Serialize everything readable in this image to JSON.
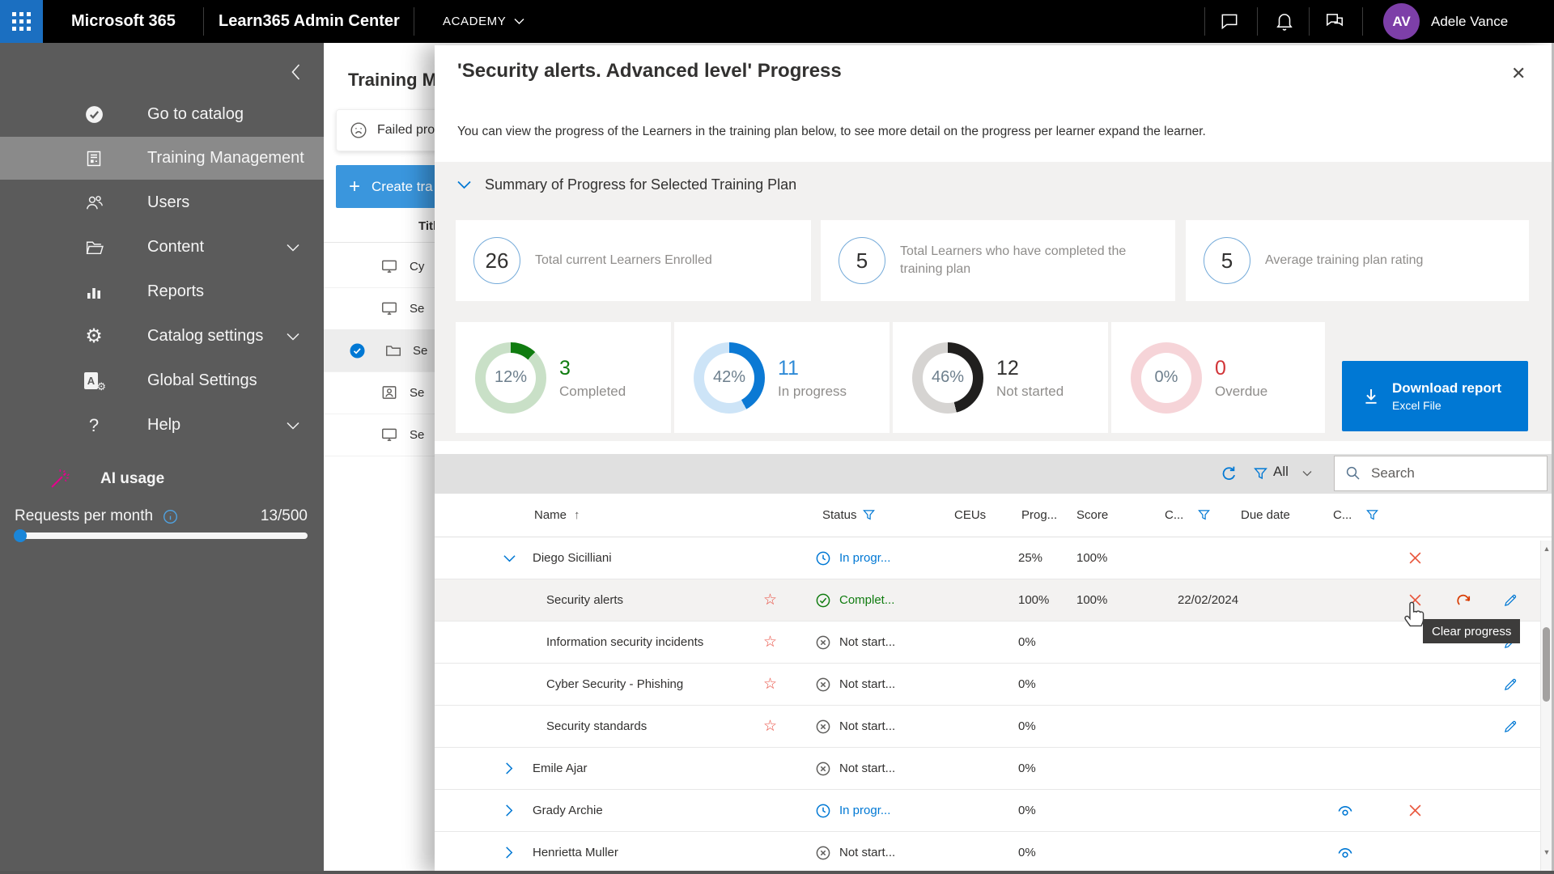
{
  "icons": {
    "close": "✕",
    "sort_asc": "↑",
    "plus": "+",
    "help": "?",
    "gear": "⚙",
    "chevron_left": "‹",
    "scroll_up": "▲",
    "scroll_down": "▼",
    "star": "☆",
    "letter_a": "A"
  },
  "colors": {
    "accent": "#0078d4",
    "completed": "#107c10",
    "inprogress": "#0078d4",
    "danger": "#e9573d",
    "redo": "#d83b01",
    "star": "#e8493c"
  },
  "topbar": {
    "brand": "Microsoft 365",
    "app_title": "Learn365 Admin Center",
    "tenant": "ACADEMY",
    "user_initials": "AV",
    "user_name": "Adele Vance"
  },
  "sidebar": {
    "items": [
      {
        "label": "Go to catalog"
      },
      {
        "label": "Training Management"
      },
      {
        "label": "Users"
      },
      {
        "label": "Content"
      },
      {
        "label": "Reports"
      },
      {
        "label": "Catalog settings"
      },
      {
        "label": "Global Settings"
      },
      {
        "label": "Help"
      },
      {
        "label": "AI usage"
      }
    ],
    "usage": {
      "label": "Requests per month",
      "value": "13/500"
    }
  },
  "background_page": {
    "title": "Training M",
    "toast": "Failed pro",
    "create_button": "Create tra",
    "table_header": "Titl",
    "rows": [
      {
        "label": "Cy"
      },
      {
        "label": "Se"
      },
      {
        "label": "Se"
      },
      {
        "label": "Se"
      },
      {
        "label": "Se"
      }
    ]
  },
  "modal": {
    "title": "'Security alerts. Advanced level' Progress",
    "description": "You can view the progress of the Learners in the training plan below, to see more detail on the progress per learner expand the learner.",
    "summary": {
      "header": "Summary of Progress for Selected Training Plan",
      "stats": [
        {
          "value": "26",
          "label": "Total current Learners Enrolled"
        },
        {
          "value": "5",
          "label": "Total Learners who have completed the training plan"
        },
        {
          "value": "5",
          "label": "Average training plan rating"
        }
      ],
      "donuts": [
        {
          "percent": 12,
          "percent_label": "12%",
          "value": "3",
          "label": "Completed",
          "color": "#107c10",
          "track": "#c9e0c7",
          "value_color": "#107c10"
        },
        {
          "percent": 42,
          "percent_label": "42%",
          "value": "11",
          "label": "In progress",
          "color": "#0b79d4",
          "track": "#cde4f7",
          "value_color": "#2e8ad6"
        },
        {
          "percent": 46,
          "percent_label": "46%",
          "value": "12",
          "label": "Not started",
          "color": "#201f1e",
          "track": "#d6d4d2",
          "value_color": "#323130"
        },
        {
          "percent": 0,
          "percent_label": "0%",
          "value": "0",
          "label": "Overdue",
          "color": "#d13438",
          "track": "#f6d4d8",
          "value_color": "#d13438"
        }
      ],
      "download_button": {
        "label": "Download report",
        "sublabel": "Excel File"
      }
    },
    "toolbar": {
      "filter_value": "All",
      "search_placeholder": "Search"
    },
    "table": {
      "columns": [
        "Name",
        "Status",
        "CEUs",
        "Prog...",
        "Score",
        "C...",
        "Due date",
        "C..."
      ],
      "rows": [
        {
          "kind": "learner",
          "expanded": true,
          "name": "Diego Sicilliani",
          "status": "inprogress",
          "status_label": "In progr...",
          "progress": "25%",
          "score": "100%",
          "due": "",
          "actions": [
            "clear"
          ]
        },
        {
          "kind": "course",
          "starred": true,
          "name": "Security alerts",
          "status": "completed",
          "status_label": "Complet...",
          "progress": "100%",
          "score": "100%",
          "due": "22/02/2024",
          "actions": [
            "clear",
            "redo",
            "edit"
          ],
          "highlighted": true
        },
        {
          "kind": "course",
          "starred": true,
          "name": "Information security incidents",
          "status": "notstarted",
          "status_label": "Not start...",
          "progress": "0%",
          "score": "",
          "due": "",
          "actions": [
            "edit"
          ]
        },
        {
          "kind": "course",
          "starred": true,
          "name": "Cyber Security - Phishing",
          "status": "notstarted",
          "status_label": "Not start...",
          "progress": "0%",
          "score": "",
          "due": "",
          "actions": [
            "edit"
          ]
        },
        {
          "kind": "course",
          "starred": true,
          "name": "Security standards",
          "status": "notstarted",
          "status_label": "Not start...",
          "progress": "0%",
          "score": "",
          "due": "",
          "actions": [
            "edit"
          ]
        },
        {
          "kind": "learner",
          "expanded": false,
          "name": "Emile Ajar",
          "status": "notstarted",
          "status_label": "Not start...",
          "progress": "0%",
          "score": "",
          "due": "",
          "actions": []
        },
        {
          "kind": "learner",
          "expanded": false,
          "name": "Grady Archie",
          "status": "inprogress",
          "status_label": "In progr...",
          "progress": "0%",
          "score": "",
          "due": "",
          "actions": [
            "view",
            "clear"
          ]
        },
        {
          "kind": "learner",
          "expanded": false,
          "name": "Henrietta Muller",
          "status": "notstarted",
          "status_label": "Not start...",
          "progress": "0%",
          "score": "",
          "due": "",
          "actions": [
            "view"
          ]
        }
      ]
    },
    "tooltip": "Clear progress"
  }
}
